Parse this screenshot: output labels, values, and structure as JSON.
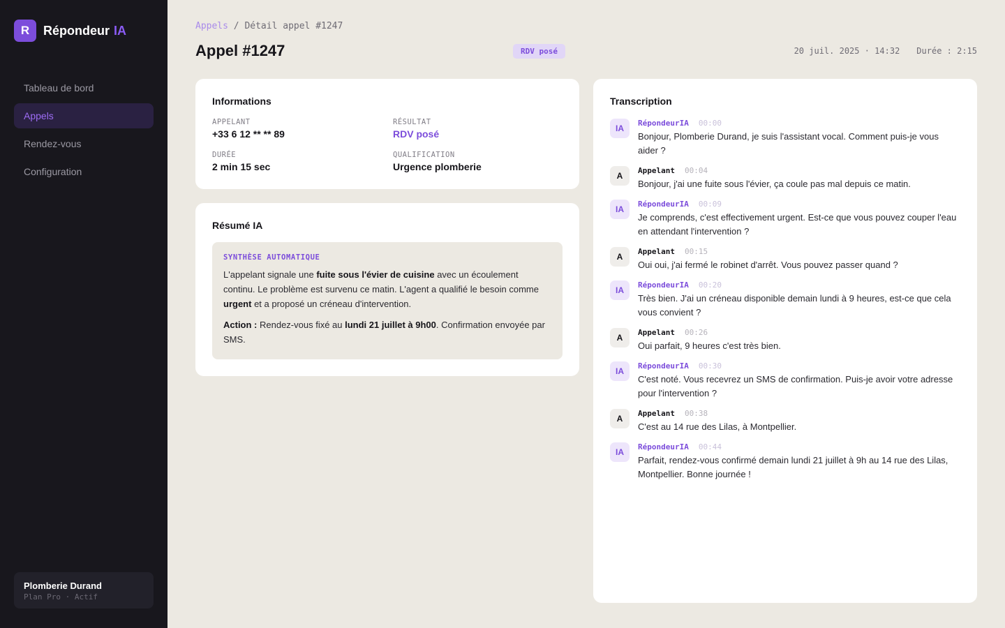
{
  "sidebar": {
    "logo_letter": "R",
    "brand_name": "Répondeur",
    "brand_accent": "IA",
    "nav": [
      {
        "label": "Tableau de bord"
      },
      {
        "label": "Appels"
      },
      {
        "label": "Rendez-vous"
      },
      {
        "label": "Configuration"
      }
    ],
    "account": {
      "name": "Plomberie Durand",
      "plan": "Plan Pro · Actif"
    }
  },
  "breadcrumb": {
    "link": "Appels",
    "separator": " / ",
    "current": "Détail appel #1247"
  },
  "header": {
    "title": "Appel #1247",
    "status": "RDV posé",
    "date": "20 juil. 2025 · 14:32",
    "duration": "Durée : 2:15"
  },
  "info": {
    "title": "Informations",
    "caller_label": "APPELANT",
    "caller_value": "+33 6 12 ** ** 89",
    "result_label": "RÉSULTAT",
    "result_value": "RDV posé",
    "duration_label": "DURÉE",
    "duration_value": "2 min 15 sec",
    "qualification_label": "QUALIFICATION",
    "qualification_value": "Urgence plomberie"
  },
  "summary": {
    "title": "Résumé IA",
    "tag": "SYNTHÈSE AUTOMATIQUE",
    "p1": [
      "L'appelant signale une ",
      "fuite sous l'évier de cuisine",
      " avec un écoulement continu. Le problème est survenu ce matin. L'agent a qualifié le besoin comme ",
      "urgent",
      " et a proposé un créneau d'intervention."
    ],
    "p2": [
      "Action :",
      " Rendez-vous fixé au ",
      "lundi 21 juillet à 9h00",
      ". Confirmation envoyée par SMS."
    ]
  },
  "transcript": {
    "title": "Transcription",
    "messages": [
      {
        "avatar": "IA",
        "speaker": "RépondeurIA",
        "time": "00:00",
        "text": "Bonjour, Plomberie Durand, je suis l'assistant vocal. Comment puis-je vous aider ?"
      },
      {
        "avatar": "A",
        "speaker": "Appelant",
        "time": "00:04",
        "text": "Bonjour, j'ai une fuite sous l'évier, ça coule pas mal depuis ce matin."
      },
      {
        "avatar": "IA",
        "speaker": "RépondeurIA",
        "time": "00:09",
        "text": "Je comprends, c'est effectivement urgent. Est-ce que vous pouvez couper l'eau en attendant l'intervention ?"
      },
      {
        "avatar": "A",
        "speaker": "Appelant",
        "time": "00:15",
        "text": "Oui oui, j'ai fermé le robinet d'arrêt. Vous pouvez passer quand ?"
      },
      {
        "avatar": "IA",
        "speaker": "RépondeurIA",
        "time": "00:20",
        "text": "Très bien. J'ai un créneau disponible demain lundi à 9 heures, est-ce que cela vous convient ?"
      },
      {
        "avatar": "A",
        "speaker": "Appelant",
        "time": "00:26",
        "text": "Oui parfait, 9 heures c'est très bien."
      },
      {
        "avatar": "IA",
        "speaker": "RépondeurIA",
        "time": "00:30",
        "text": "C'est noté. Vous recevrez un SMS de confirmation. Puis-je avoir votre adresse pour l'intervention ?"
      },
      {
        "avatar": "A",
        "speaker": "Appelant",
        "time": "00:38",
        "text": "C'est au 14 rue des Lilas, à Montpellier."
      },
      {
        "avatar": "IA",
        "speaker": "RépondeurIA",
        "time": "00:44",
        "text": "Parfait, rendez-vous confirmé demain lundi 21 juillet à 9h au 14 rue des Lilas, Montpellier. Bonne journée !"
      }
    ]
  },
  "colors": {
    "accent": "#7c4ddb",
    "sidebar_bg": "#18171d",
    "page_bg": "#ece9e2"
  }
}
